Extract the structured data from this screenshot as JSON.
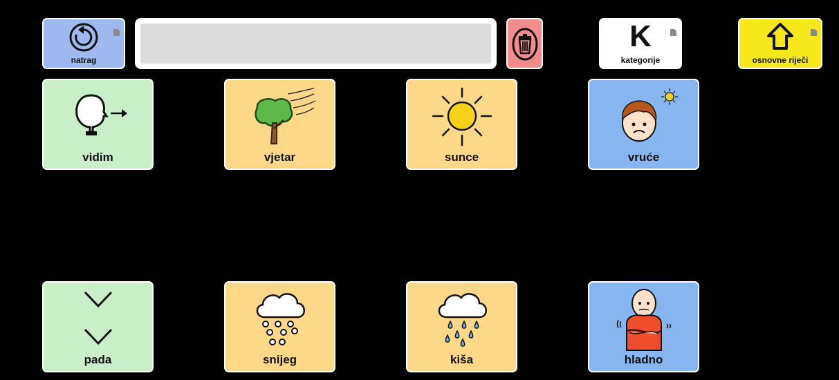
{
  "toolbar": {
    "back": {
      "label": "natrag",
      "icon": "undo-icon",
      "color": "#9eb8f0"
    },
    "delete": {
      "icon": "trash-icon",
      "color": "#f08c8c"
    },
    "categories": {
      "label": "kategorije",
      "glyph": "K",
      "color": "#ffffff"
    },
    "home": {
      "label": "osnovne riječi",
      "icon": "house-icon",
      "color": "#f7e81c"
    }
  },
  "sentence": {
    "text": ""
  },
  "tiles": [
    {
      "label": "vidim",
      "icon": "see-icon",
      "color": "#c9efc9"
    },
    {
      "label": "vjetar",
      "icon": "wind-tree-icon",
      "color": "#fdd889"
    },
    {
      "label": "sunce",
      "icon": "sun-icon",
      "color": "#fdd889"
    },
    {
      "label": "vruće",
      "icon": "hot-face-icon",
      "color": "#86b5f0"
    },
    {
      "label": "pada",
      "icon": "falling-arrows-icon",
      "color": "#c9efc9"
    },
    {
      "label": "snijeg",
      "icon": "snow-cloud-icon",
      "color": "#fdd889"
    },
    {
      "label": "kiša",
      "icon": "rain-cloud-icon",
      "color": "#fdd889"
    },
    {
      "label": "hladno",
      "icon": "cold-person-icon",
      "color": "#86b5f0"
    }
  ]
}
